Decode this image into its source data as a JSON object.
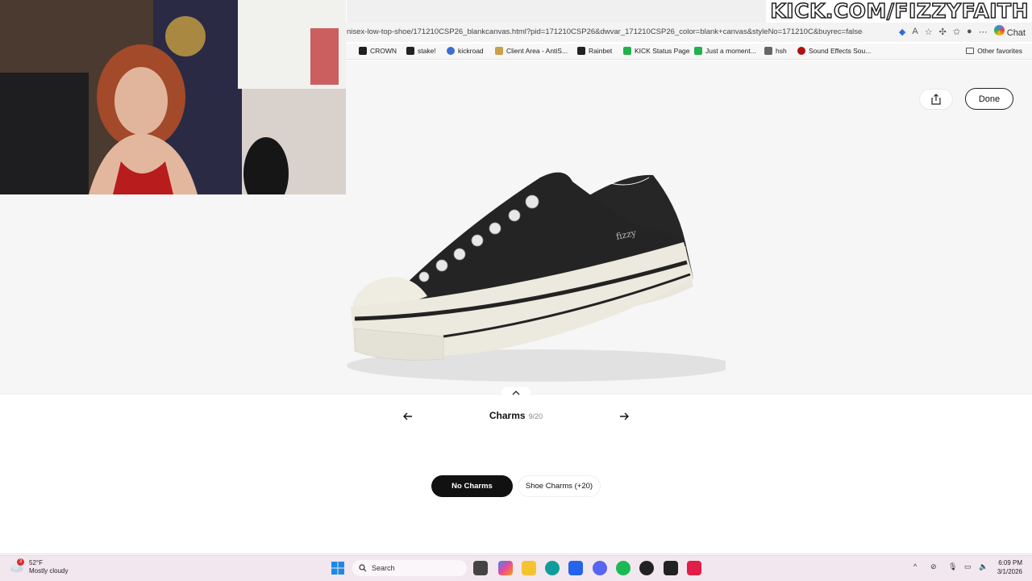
{
  "stream": {
    "watermark": "KICK.COM/FIZZYFAITH"
  },
  "browser": {
    "url": "nisex-low-top-shoe/171210CSP26_blankcanvas.html?pid=171210CSP26&dwvar_171210CSP26_color=blank+canvas&styleNo=171210C&buyrec=false&p...",
    "chat_label": "Chat",
    "bookmarks": [
      {
        "label": "CROWN",
        "color": "#1f1f1f"
      },
      {
        "label": "stake!",
        "color": "#222222"
      },
      {
        "label": "kickroad",
        "color": "#3b6fd1"
      },
      {
        "label": "Client Area - AntiS...",
        "color": "#caa04a"
      },
      {
        "label": "Rainbet",
        "color": "#222222"
      },
      {
        "label": "KICK Status Page",
        "color": "#22b14c"
      },
      {
        "label": "Just a moment...",
        "color": "#22b14c"
      },
      {
        "label": "hsh",
        "color": "#666666"
      },
      {
        "label": "Sound Effects Sou...",
        "color": "#b01010"
      }
    ],
    "other_bookmarks": "Other favorites"
  },
  "viewer": {
    "done_label": "Done",
    "shoe_signature": "fizzy"
  },
  "customizer": {
    "category": "Charms",
    "counter": "9/20",
    "options": [
      {
        "label": "No Charms",
        "selected": true
      },
      {
        "label": "Shoe Charms (+20)",
        "selected": false
      }
    ]
  },
  "taskbar": {
    "weather_temp": "52°F",
    "weather_desc": "Mostly cloudy",
    "weather_badge": "3",
    "search_placeholder": "Search",
    "time": "6:09 PM",
    "date": "3/1/2026"
  },
  "colors": {
    "accent": "#111111",
    "viewer_bg": "#f6f6f6",
    "taskbar_bg": "#f2e7ee"
  }
}
